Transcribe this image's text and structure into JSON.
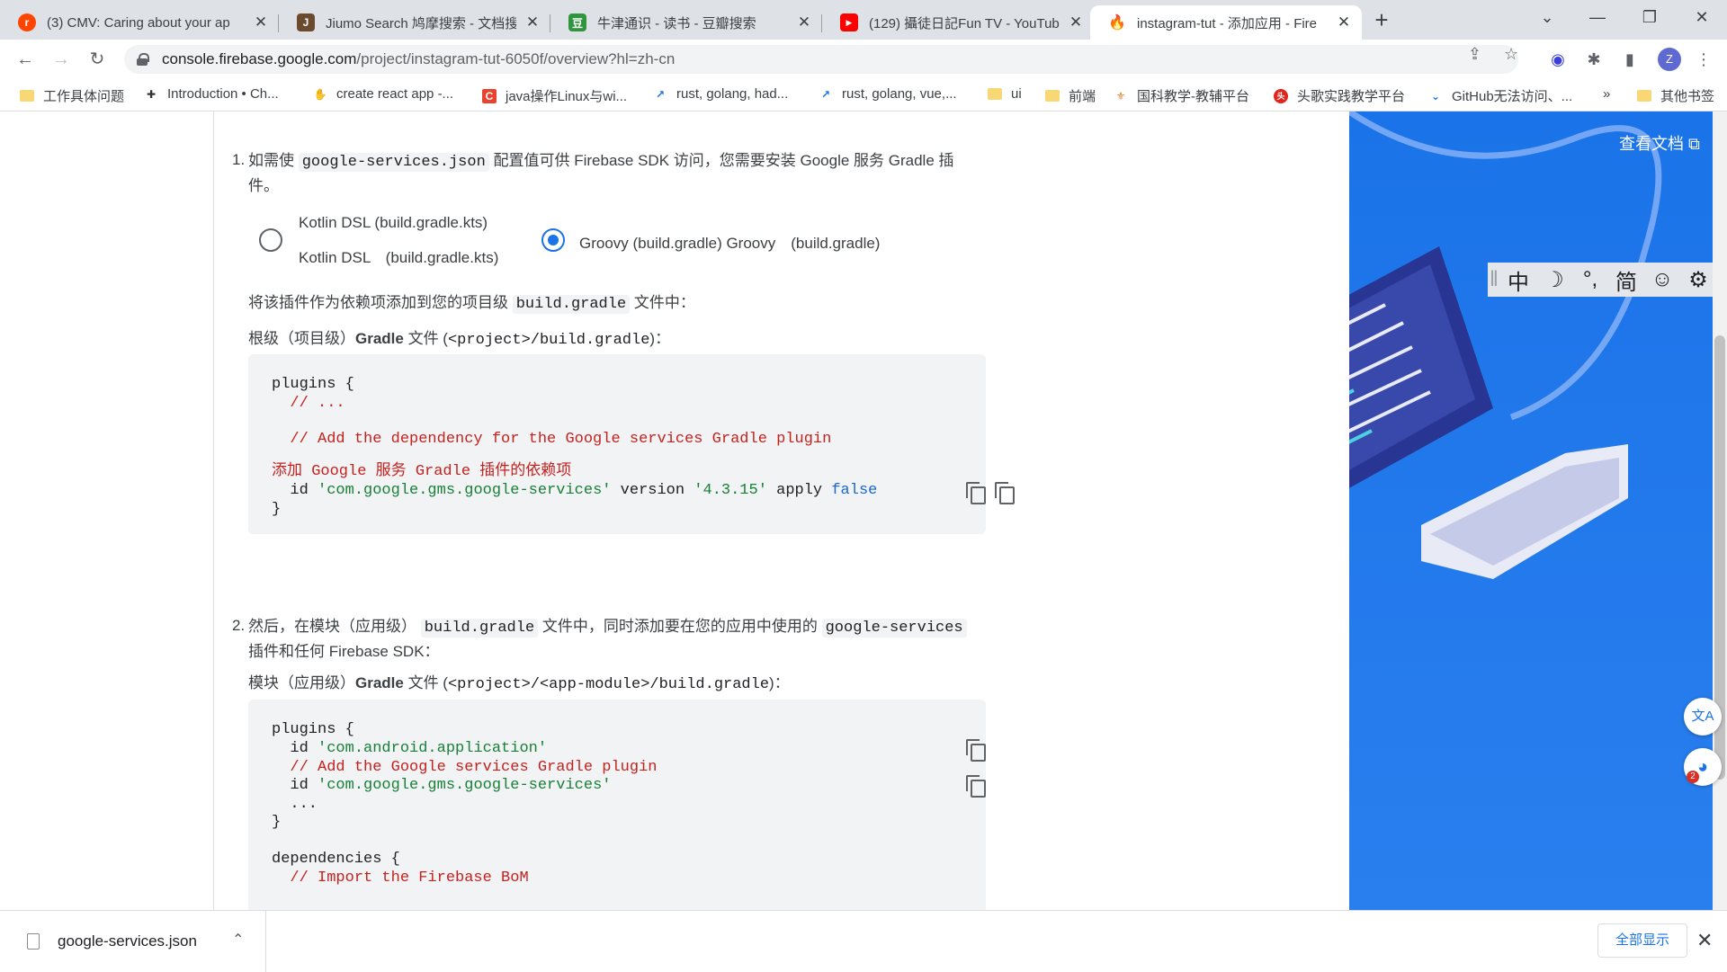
{
  "tabs": [
    {
      "title": "(3) CMV: Caring about your ap",
      "favicon_color": "#ff4500",
      "favicon_text": "r"
    },
    {
      "title": "Jiumo Search 鸠摩搜索 - 文档搜",
      "favicon_color": "#6b4a2e",
      "favicon_text": "J"
    },
    {
      "title": "牛津通识 - 读书 - 豆瓣搜索",
      "favicon_color": "#2e963d",
      "favicon_text": "豆"
    },
    {
      "title": "(129) 攝徒日記Fun TV - YouTub",
      "favicon_color": "#ff0000",
      "favicon_text": "▶"
    },
    {
      "title": "instagram-tut - 添加应用 - Fire",
      "favicon_color": "#ffa000",
      "favicon_text": "🔥"
    }
  ],
  "window": {
    "new_tab": "+",
    "minimize": "—",
    "maximize": "❐",
    "close": "✕",
    "tab_search": "⌄"
  },
  "toolbar": {
    "back": "←",
    "forward": "→",
    "reload": "↻",
    "url_domain": "console.firebase.google.com",
    "url_path": "/project/instagram-tut-6050f/overview?hl=zh-cn",
    "avatar_letter": "Z"
  },
  "bookmarks": [
    {
      "label": "工作具体问题",
      "icon": "folder-icon"
    },
    {
      "label": "Introduction • Ch...",
      "icon": "plus-icon"
    },
    {
      "label": "create react app -...",
      "icon": "hand-icon"
    },
    {
      "label": "java操作Linux与wi...",
      "icon": "c-icon"
    },
    {
      "label": "rust, golang, had...",
      "icon": "trend-icon"
    },
    {
      "label": "rust, golang, vue,...",
      "icon": "trend-icon"
    },
    {
      "label": "ui",
      "icon": "folder-icon"
    },
    {
      "label": "前端",
      "icon": "folder-icon"
    },
    {
      "label": "国科教学-教辅平台",
      "icon": "school-icon"
    },
    {
      "label": "头歌实践教学平台",
      "icon": "toutiao-icon"
    },
    {
      "label": "GitHub无法访问、...",
      "icon": "chevron-icon"
    },
    {
      "label": "»",
      "icon": ""
    },
    {
      "label": "其他书签",
      "icon": "folder-icon"
    }
  ],
  "content": {
    "step1": {
      "num": "1.",
      "text_a": "如需使 ",
      "code": "google-services.json",
      "text_b": " 配置值可供 Firebase SDK 访问，您需要安装 Google 服务 Gradle 插",
      "text_c": "件。"
    },
    "radio_kotlin": {
      "line1": "Kotlin DSL (build.gradle.kts)",
      "line2": "Kotlin DSL　(build.gradle.kts)",
      "checked": false
    },
    "radio_groovy": {
      "label": "Groovy (build.gradle) Groovy　(build.gradle)",
      "checked": true
    },
    "add_plugin_text": "将该插件作为依赖项添加到您的项目级 ",
    "add_plugin_code": "build.gradle",
    "add_plugin_suffix": " 文件中：",
    "root_label_a": "根级（项目级）",
    "root_label_b": "Gradle",
    "root_label_c": " 文件 (",
    "root_label_code": "<project>/build.gradle",
    "root_label_d": ")：",
    "code1": {
      "l1": "plugins {",
      "l2": "  // ...",
      "l3": "  // Add the dependency for the Google services Gradle plugin",
      "l4": "添加 Google 服务 Gradle 插件的依赖项",
      "l5a": "  id ",
      "l5b": "'com.google.gms.google-services'",
      "l5c": " version ",
      "l5d": "'4.3.15'",
      "l5e": " apply ",
      "l5f": "false",
      "l6": "}"
    },
    "step2": {
      "num": "2.",
      "text_a": "然后，在模块（应用级） ",
      "code_a": "build.gradle",
      "text_b": " 文件中，同时添加要在您的应用中使用的 ",
      "code_b": "google-services",
      "text_c": "插件和任何 Firebase SDK："
    },
    "module_label_a": "模块（应用级）",
    "module_label_b": "Gradle",
    "module_label_c": " 文件 (",
    "module_label_code": "<project>/<app-module>/build.gradle",
    "module_label_d": ")：",
    "code2": {
      "l1": "plugins {",
      "l2a": "  id ",
      "l2b": "'com.android.application'",
      "l3": "  // Add the Google services Gradle plugin",
      "l4a": "  id ",
      "l4b": "'com.google.gms.google-services'",
      "l5": "  ...",
      "l6": "}",
      "l7": "dependencies {",
      "l8": "  // Import the Firebase BoM"
    }
  },
  "hero": {
    "docs_link": "查看文档"
  },
  "ime": {
    "items": [
      "中",
      "☽",
      "°,",
      "简",
      "☺",
      "⚙"
    ]
  },
  "floating": {
    "translate": "文A",
    "assistant_badge": "2"
  },
  "download_shelf": {
    "file_name": "google-services.json",
    "show_all": "全部显示",
    "close": "✕"
  }
}
